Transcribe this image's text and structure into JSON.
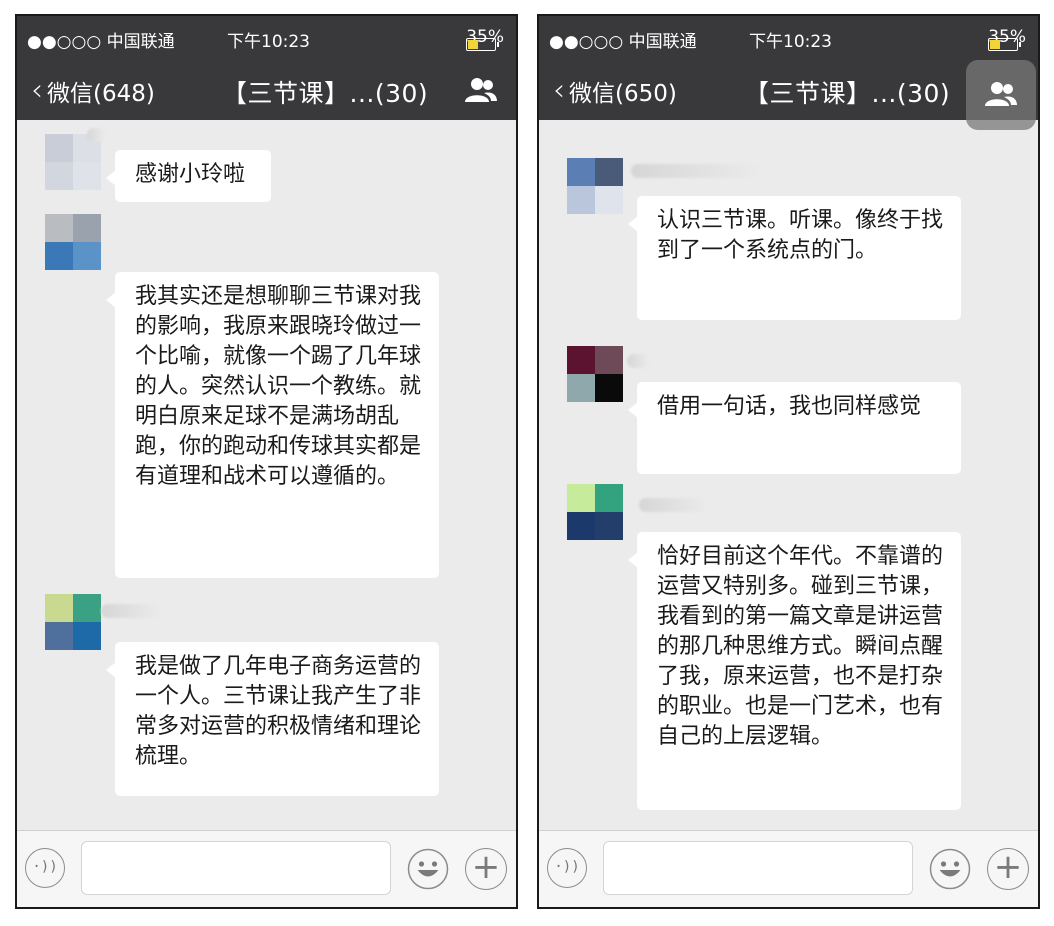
{
  "screens": [
    {
      "statusbar": {
        "carrier": "●●○○○ 中国联通",
        "time": "下午10:23",
        "battery": "35%"
      },
      "nav": {
        "back_label": "微信(648)",
        "title": "【三节课】...(30)",
        "members_icon": "members-icon"
      },
      "messages": [
        {
          "text": "感谢小玲啦",
          "avatar_colors": [
            "#c0c6d4",
            "#d9dde6",
            "#cdd2dc",
            "#dde1e8"
          ]
        },
        {
          "text": "我其实还是想聊聊三节课对我的影响，我原来跟晓玲做过一个比喻，就像一个踢了几年球的人。突然认识一个教练。就明白原来足球不是满场胡乱跑，你的跑动和传球其实都是有道理和战术可以遵循的。",
          "avatar_colors": [
            "#1f2a26",
            "#2e70a6",
            "#3a78b8",
            "#5b93c9"
          ]
        },
        {
          "text": "我是做了几年电子商务运营的一个人。三节课让我产生了非常多对运营的积极情绪和理论梳理。",
          "avatar_colors": [
            "#2d5f8f",
            "#152b4a",
            "#4f7d7f",
            "#1e6aa8"
          ]
        }
      ],
      "input": {
        "voice_icon": "voice-icon",
        "emoji_icon": "emoji-icon",
        "plus_icon": "plus-icon",
        "plus_glyph": "+",
        "voice_glyph": "·))"
      }
    },
    {
      "statusbar": {
        "carrier": "●●○○○ 中国联通",
        "time": "下午10:23",
        "battery": "35%"
      },
      "nav": {
        "back_label": "微信(650)",
        "title": "【三节课】...(30)",
        "members_icon": "members-icon"
      },
      "messages": [
        {
          "text": "认识三节课。听课。像终于找到了一个系统点的门。",
          "avatar_colors": [
            "#5b7fb5",
            "#4a5b7a",
            "#b9c6dc",
            "#dfe4ec"
          ]
        },
        {
          "text": "借用一句话，我也同样感觉",
          "avatar_colors": [
            "#5c1330",
            "#6e4a58",
            "#8fa8ab",
            "#0a0a0a"
          ]
        },
        {
          "text": "恰好目前这个年代。不靠谱的运营又特别多。碰到三节课，我看到的第一篇文章是讲运营的那几种思维方式。瞬间点醒了我，原来运营，也不是打杂的职业。也是一门艺术，也有自己的上层逻辑。",
          "avatar_colors": [
            "#2f4e70",
            "#0f2138",
            "#1b3a6b",
            "#243e6c"
          ]
        }
      ],
      "input": {
        "voice_icon": "voice-icon",
        "emoji_icon": "emoji-icon",
        "plus_icon": "plus-icon",
        "plus_glyph": "+",
        "voice_glyph": "·))"
      }
    }
  ]
}
